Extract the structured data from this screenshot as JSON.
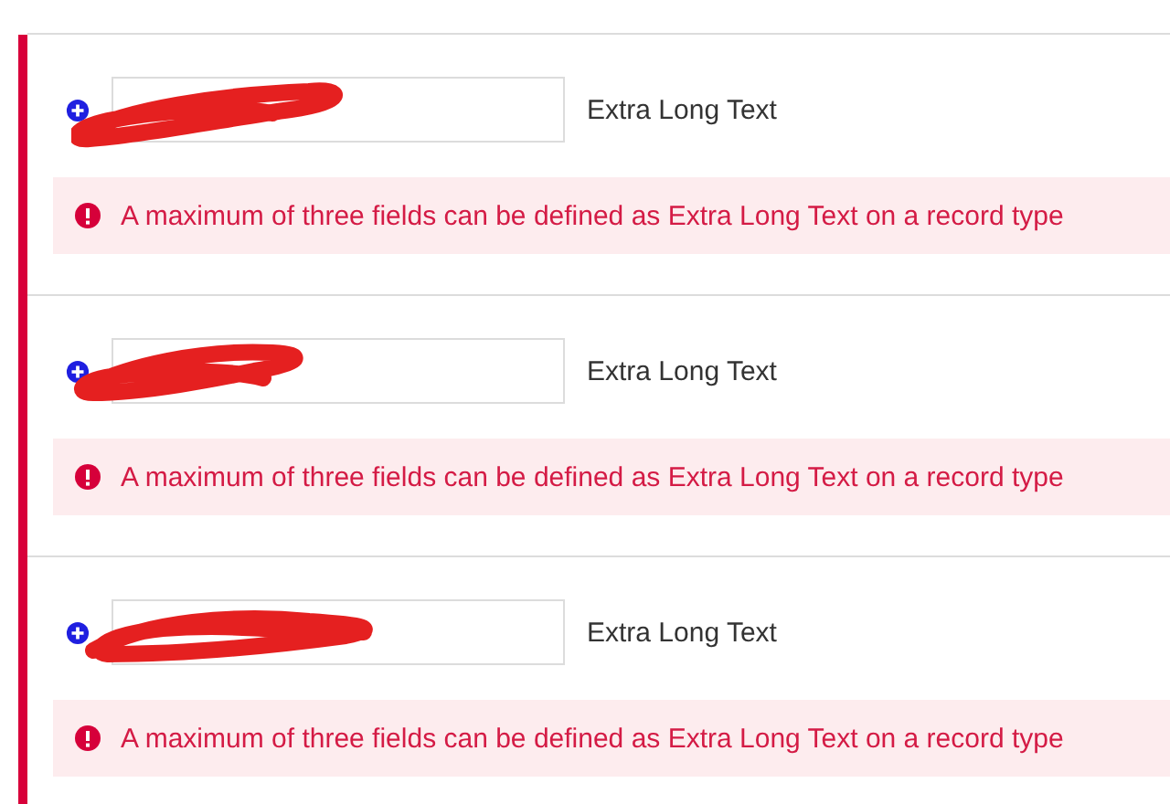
{
  "rows": [
    {
      "field": {
        "redacted": true
      },
      "type_label": "Extra Long Text",
      "error": "A maximum of three fields can be defined as Extra Long Text on a record type"
    },
    {
      "field": {
        "redacted": true
      },
      "type_label": "Extra Long Text",
      "error": "A maximum of three fields can be defined as Extra Long Text on a record type"
    },
    {
      "field": {
        "redacted": true
      },
      "type_label": "Extra Long Text",
      "error": "A maximum of three fields can be defined as Extra Long Text on a record type"
    }
  ]
}
